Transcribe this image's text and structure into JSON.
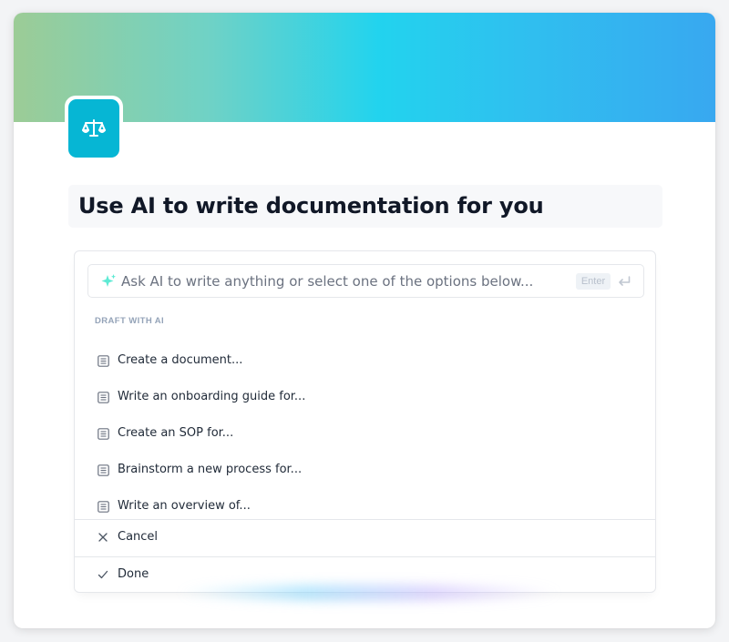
{
  "page": {
    "title": "Use AI to write documentation for you",
    "app_icon": "scales-icon",
    "banner_colors": [
      "#9ccc96",
      "#22d3ee",
      "#38a8f0"
    ],
    "icon_color": "#06b6d4"
  },
  "ai_panel": {
    "prompt_placeholder": "Ask AI to write anything or select one of the options below...",
    "enter_label": "Enter",
    "section_label": "DRAFT WITH AI",
    "options": [
      {
        "label": "Create a document...",
        "icon": "document-list-icon"
      },
      {
        "label": "Write an onboarding guide for...",
        "icon": "document-list-icon"
      },
      {
        "label": "Create an SOP for...",
        "icon": "document-list-icon"
      },
      {
        "label": "Brainstorm a new process for...",
        "icon": "document-list-icon"
      },
      {
        "label": "Write an overview of...",
        "icon": "document-list-icon"
      }
    ],
    "actions": {
      "cancel_label": "Cancel",
      "done_label": "Done"
    }
  }
}
